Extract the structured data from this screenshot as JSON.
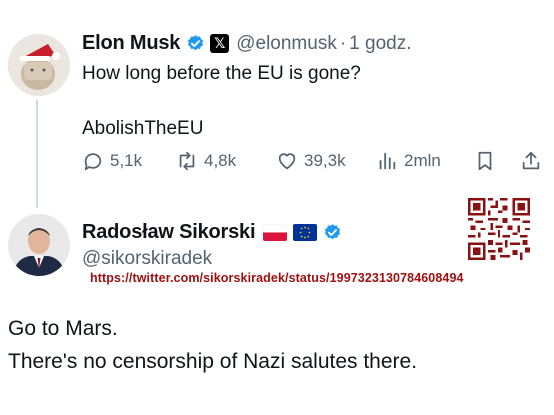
{
  "original": {
    "name": "Elon Musk",
    "handle": "@elonmusk",
    "separator": "·",
    "time": "1 godz.",
    "text_line1": "How long before the EU is gone?",
    "text_line2": "AbolishTheEU",
    "actions": {
      "replies": "5,1k",
      "reposts": "4,8k",
      "likes": "39,3k",
      "views": "2mln"
    }
  },
  "reply": {
    "name": "Radosław Sikorski",
    "handle": "@sikorskiradek",
    "status_url": "https://twitter.com/sikorskiradek/status/1997323130784608494",
    "text_line1": "Go to Mars.",
    "text_line2": "There's no censorship of Nazi salutes there."
  },
  "icons": {
    "verified": "verified-badge-icon",
    "x_logo": "x-logo-icon",
    "reply": "reply-icon",
    "repost": "repost-icon",
    "like": "heart-icon",
    "views": "views-icon",
    "bookmark": "bookmark-icon",
    "share": "share-icon",
    "qr": "qr-code-icon"
  },
  "colors": {
    "verified_blue": "#1d9bf0",
    "muted": "#536471",
    "url_red": "#a01010"
  }
}
